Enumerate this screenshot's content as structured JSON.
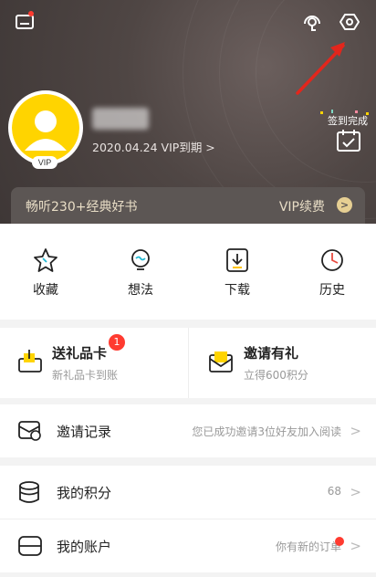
{
  "header": {
    "vip_expiry": "2020.04.24 VIP到期 >",
    "avatar_badge": "VIP",
    "checkin_label": "签到完成",
    "vip_banner": {
      "left_text": "畅听230+经典好书",
      "right_text": "VIP续费",
      "arrow": ">"
    }
  },
  "quick_actions": [
    {
      "label": "收藏",
      "icon": "star-icon"
    },
    {
      "label": "想法",
      "icon": "bulb-icon"
    },
    {
      "label": "下载",
      "icon": "download-icon"
    },
    {
      "label": "历史",
      "icon": "clock-icon"
    }
  ],
  "gifts": {
    "send_card": {
      "title": "送礼品卡",
      "subtitle": "新礼品卡到账",
      "badge": "1"
    },
    "invite": {
      "title": "邀请有礼",
      "subtitle": "立得600积分"
    }
  },
  "rows": {
    "invite_record": {
      "label": "邀请记录",
      "value": "您已成功邀请3位好友加入阅读",
      "chevron": ">"
    },
    "points": {
      "label": "我的积分",
      "value": "68",
      "chevron": ">"
    },
    "account": {
      "label": "我的账户",
      "value": "你有新的订单",
      "chevron": ">"
    }
  },
  "colors": {
    "header_bg": "#4f4644",
    "accent_yellow": "#ffd400",
    "gold": "#e6cf93",
    "badge_red": "#ff3b30"
  }
}
